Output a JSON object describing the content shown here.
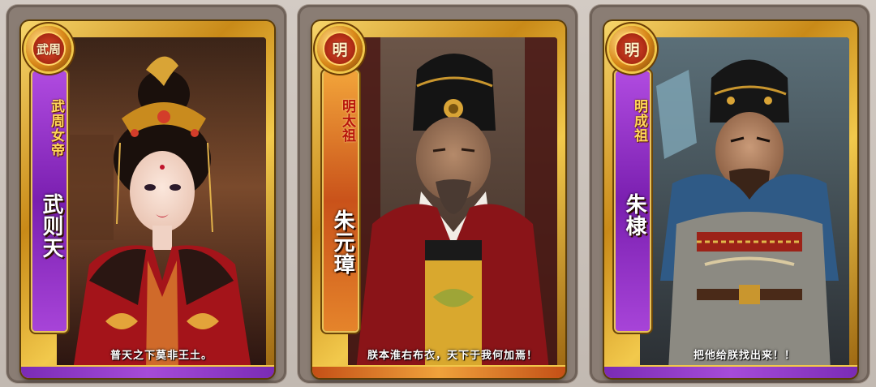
{
  "cards": [
    {
      "dynasty_mark": "武周",
      "title": "武周女帝",
      "name": "武则天",
      "quote": "普天之下莫非王土。",
      "banner_color": "#9a33cf",
      "portrait_icon": "empress-portrait-icon"
    },
    {
      "dynasty_mark": "明",
      "title": "明太祖",
      "name": "朱元璋",
      "quote": "朕本淮右布衣，天下于我何加焉！",
      "banner_color": "#e0782a",
      "portrait_icon": "emperor-portrait-icon"
    },
    {
      "dynasty_mark": "明",
      "title": "明成祖",
      "name": "朱棣",
      "quote": "把他给朕找出来！！",
      "banner_color": "#9a33cf",
      "portrait_icon": "warrior-emperor-portrait-icon"
    }
  ]
}
